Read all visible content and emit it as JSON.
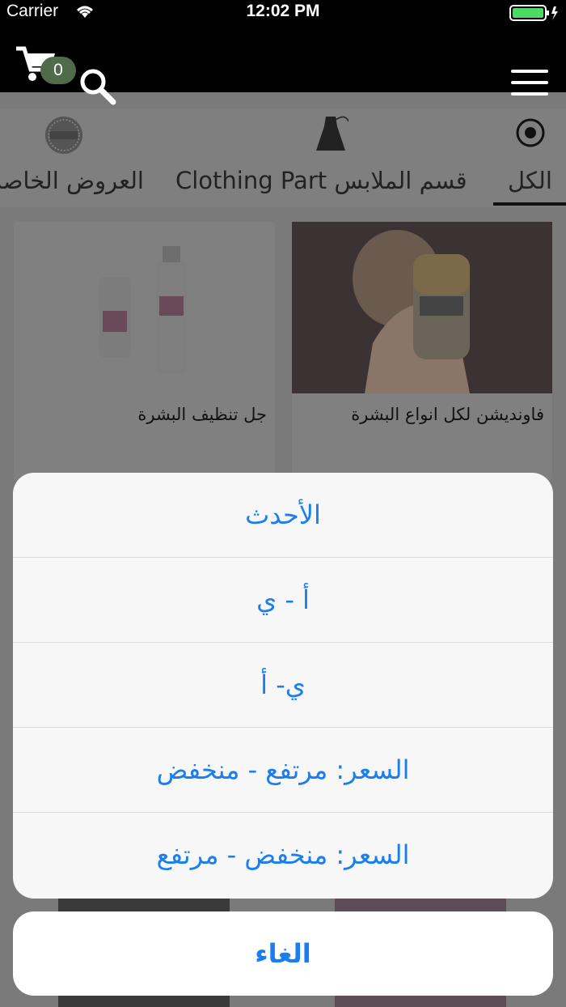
{
  "status_bar": {
    "carrier": "Carrier",
    "time": "12:02 PM"
  },
  "header": {
    "cart_count": "0",
    "icons": [
      "cart-icon",
      "search-icon",
      "menu-icon"
    ]
  },
  "categories": [
    {
      "label": "الكل",
      "icon": "target-icon",
      "active": true
    },
    {
      "label": "Clothing Part قسم الملابس",
      "icon": "dress-icon",
      "active": false
    },
    {
      "label": "العروض الخاصة",
      "icon": "special-offer-icon",
      "active": false
    }
  ],
  "products": [
    {
      "title": "فاونديشن لكل انواع البشرة"
    },
    {
      "title": "جل تنظيف البشرة"
    }
  ],
  "sort_sheet": {
    "options": [
      "الأحدث",
      "أ - ي",
      "ي- أ",
      "السعر: مرتفع - منخفض",
      "السعر: منخفض - مرتفع"
    ],
    "cancel_label": "الغاء"
  },
  "colors": {
    "accent": "#1a7ef0",
    "badge": "#506b4a"
  }
}
